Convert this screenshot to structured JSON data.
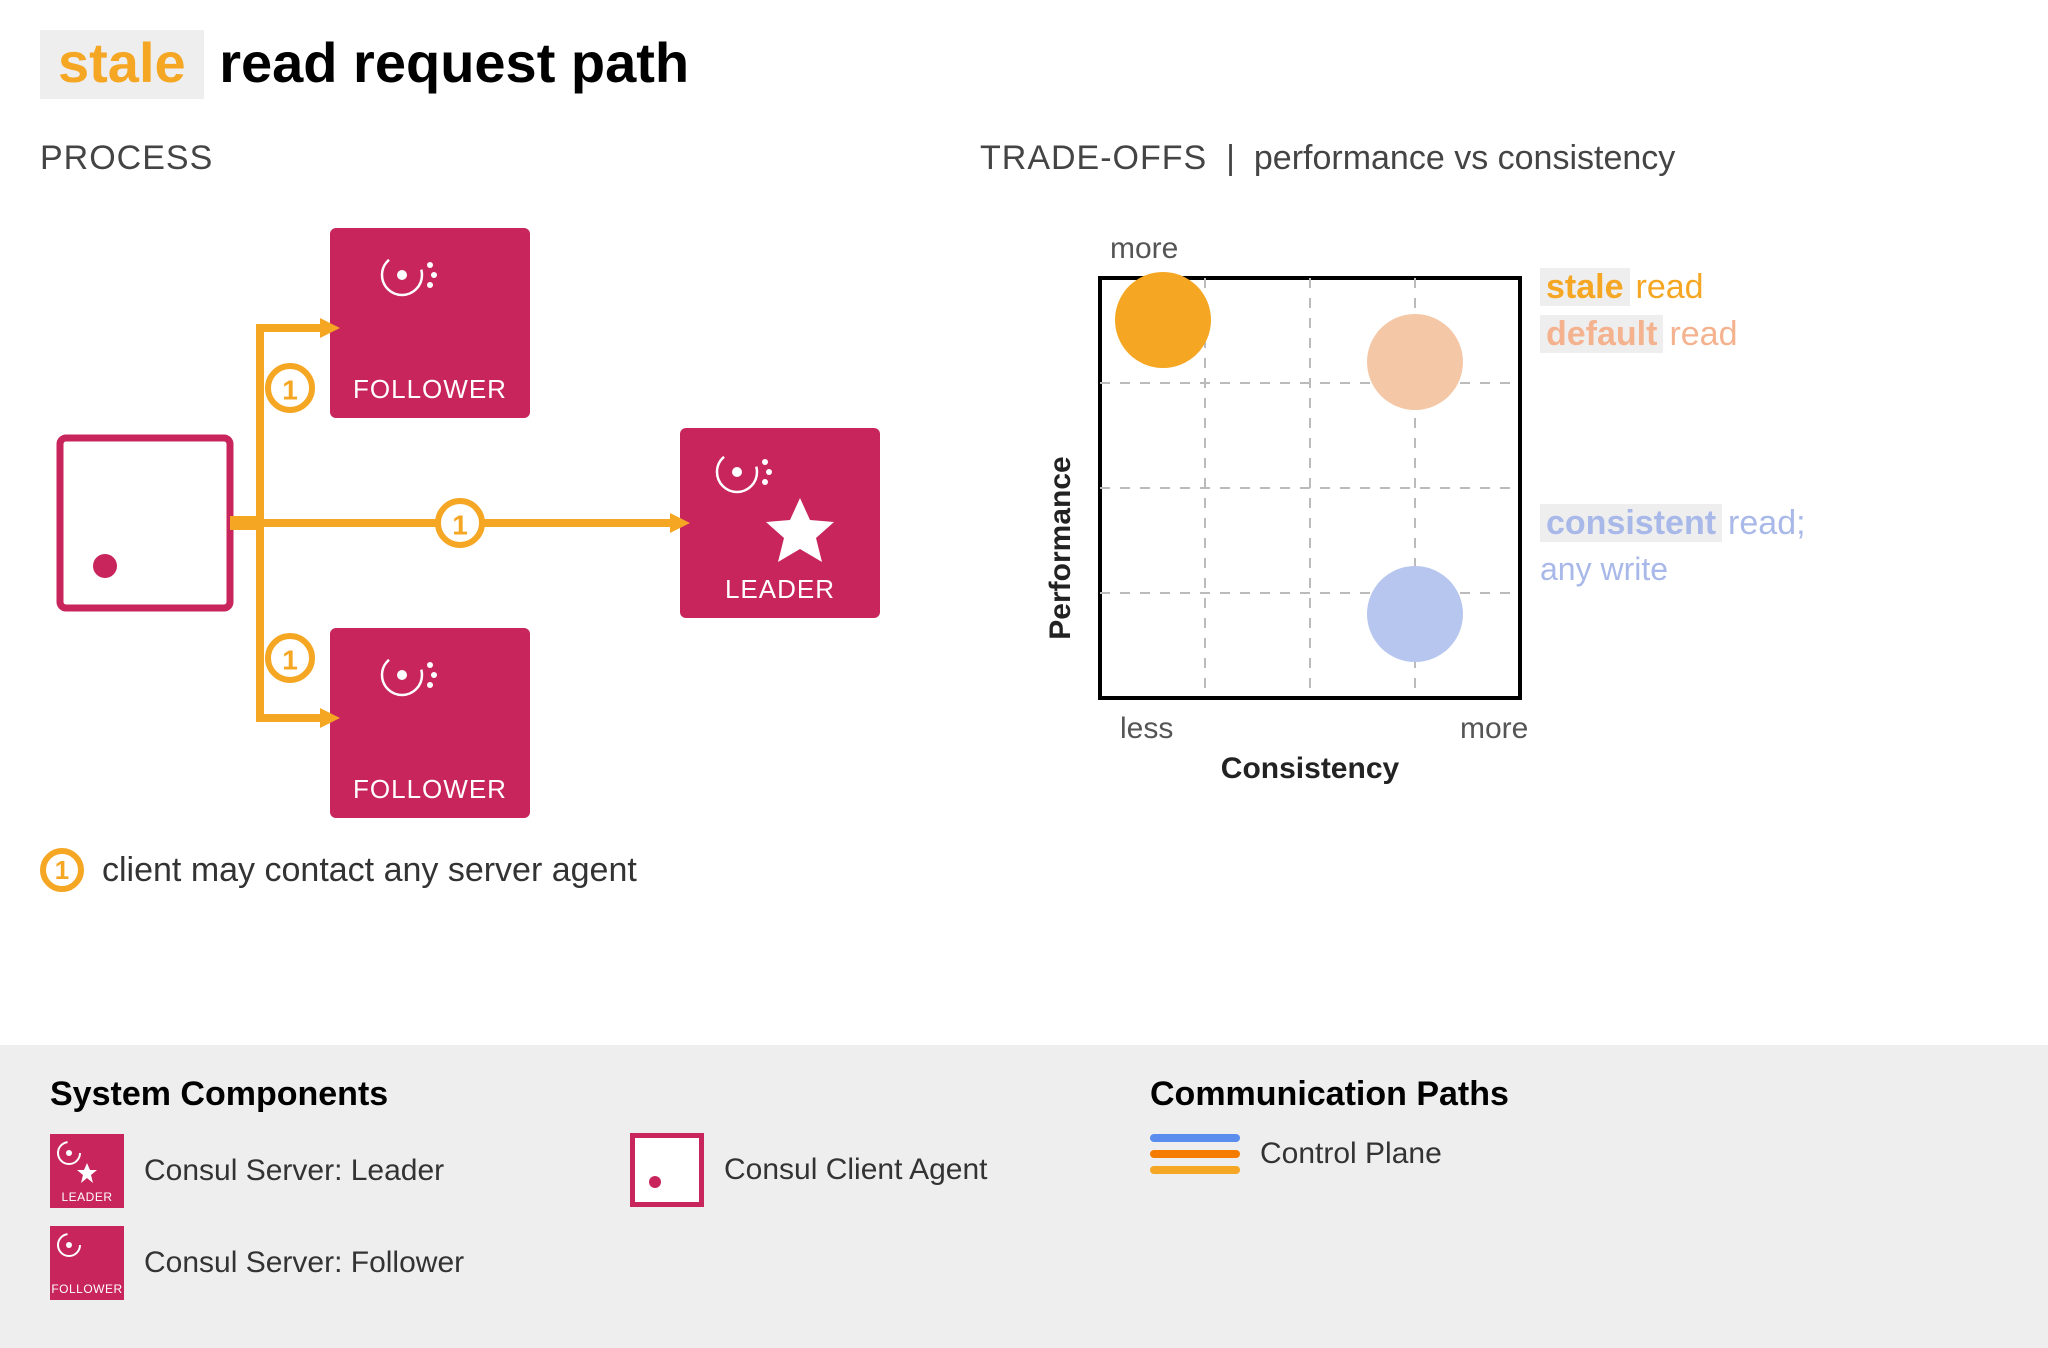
{
  "title": {
    "highlight": "stale",
    "rest": " read request path"
  },
  "process": {
    "label": "PROCESS",
    "nodes": {
      "follower_top": "FOLLOWER",
      "follower_bottom": "FOLLOWER",
      "leader": "LEADER"
    },
    "step_number": "1",
    "step_legend": "client may contact any server agent"
  },
  "tradeoff": {
    "label_prefix": "TRADE-OFFS",
    "label_sep": "|",
    "label_rest": "performance vs consistency",
    "y_axis": "Performance",
    "x_axis": "Consistency",
    "y_more": "more",
    "x_less": "less",
    "x_more": "more",
    "legend": {
      "stale_tag": "stale",
      "stale_word": "read",
      "default_tag": "default",
      "default_word": "read",
      "consistent_tag": "consistent",
      "consistent_word": "read;",
      "consistent_sub": "any write"
    }
  },
  "chart_data": {
    "type": "scatter",
    "title": "performance vs consistency",
    "xlabel": "Consistency",
    "ylabel": "Performance",
    "xlim": [
      0,
      4
    ],
    "ylim": [
      0,
      4
    ],
    "x_ticks": {
      "0": "less",
      "4": "more"
    },
    "y_ticks": {
      "4": "more"
    },
    "series": [
      {
        "name": "stale read",
        "color": "#f5a623",
        "x": 0.6,
        "y": 3.6
      },
      {
        "name": "default read",
        "color": "#f4c7a6",
        "x": 3.0,
        "y": 3.2
      },
      {
        "name": "consistent read; any write",
        "color": "#b6c6ef",
        "x": 3.0,
        "y": 0.8
      }
    ]
  },
  "footer": {
    "sys_heading": "System Components",
    "comm_heading": "Communication Paths",
    "leader_label": "Consul Server: Leader",
    "follower_label": "Consul Server: Follower",
    "client_label": "Consul Client Agent",
    "control_plane": "Control Plane",
    "mini_leader": "LEADER",
    "mini_follower": "FOLLOWER"
  }
}
